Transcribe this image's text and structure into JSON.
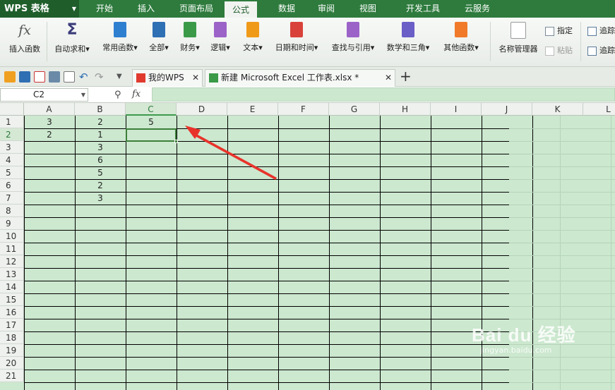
{
  "app": {
    "brand": "WPS 表格"
  },
  "menu": {
    "tabs": [
      "开始",
      "插入",
      "页面布局",
      "公式",
      "数据",
      "审阅",
      "视图",
      "开发工具",
      "云服务"
    ],
    "active": "公式"
  },
  "ribbon": {
    "buttons": [
      {
        "label": "插入函数",
        "icon": "fx-icon"
      },
      {
        "label": "自动求和▾",
        "icon": "sigma-icon"
      },
      {
        "label": "常用函数▾",
        "icon": "common-functions-icon"
      },
      {
        "label": "全部▾",
        "icon": "all-functions-icon"
      },
      {
        "label": "财务▾",
        "icon": "finance-icon"
      },
      {
        "label": "逻辑▾",
        "icon": "logic-icon"
      },
      {
        "label": "文本▾",
        "icon": "text-icon"
      },
      {
        "label": "日期和时间▾",
        "icon": "datetime-icon"
      },
      {
        "label": "查找与引用▾",
        "icon": "lookup-icon"
      },
      {
        "label": "数学和三角▾",
        "icon": "math-icon"
      },
      {
        "label": "其他函数▾",
        "icon": "other-functions-icon"
      },
      {
        "label": "名称管理器",
        "icon": "name-manager-icon"
      }
    ],
    "small_buttons": [
      {
        "label": "指定",
        "icon": "define-icon"
      },
      {
        "label": "粘贴",
        "icon": "paste-icon"
      },
      {
        "label": "追踪",
        "icon": "trace-precedents-icon"
      },
      {
        "label": "追踪",
        "icon": "trace-dependents-icon"
      }
    ]
  },
  "doc_tabs": [
    {
      "label": "我的WPS",
      "close": "✕"
    },
    {
      "label": "新建 Microsoft Excel 工作表.xlsx *",
      "close": "✕"
    }
  ],
  "new_tab": "+",
  "formula_bar": {
    "name_box": "C2",
    "fx": "fx",
    "formula": ""
  },
  "sheet": {
    "columns": [
      "A",
      "B",
      "C",
      "D",
      "E",
      "F",
      "G",
      "H",
      "I",
      "J",
      "K",
      "L"
    ],
    "rows": [
      "1",
      "2",
      "3",
      "4",
      "5",
      "6",
      "7",
      "8",
      "9",
      "10",
      "11",
      "12",
      "13",
      "14",
      "15",
      "16",
      "17",
      "18",
      "19",
      "20",
      "21"
    ],
    "selected_column": "C",
    "selected_row": "2",
    "cells": [
      {
        "ref": "A1",
        "value": "3"
      },
      {
        "ref": "B1",
        "value": "2"
      },
      {
        "ref": "C1",
        "value": "5"
      },
      {
        "ref": "A2",
        "value": "2"
      },
      {
        "ref": "B2",
        "value": "1"
      },
      {
        "ref": "B3",
        "value": "3"
      },
      {
        "ref": "B4",
        "value": "6"
      },
      {
        "ref": "B5",
        "value": "5"
      },
      {
        "ref": "B6",
        "value": "2"
      },
      {
        "ref": "B7",
        "value": "3"
      }
    ]
  },
  "watermark": {
    "main": "Bai du 经验",
    "sub": "jingyan.baidu.com"
  },
  "colors": {
    "accent": "#2e7b3d",
    "sheet_bg": "#cce8cf",
    "arrow": "#e8332b"
  }
}
